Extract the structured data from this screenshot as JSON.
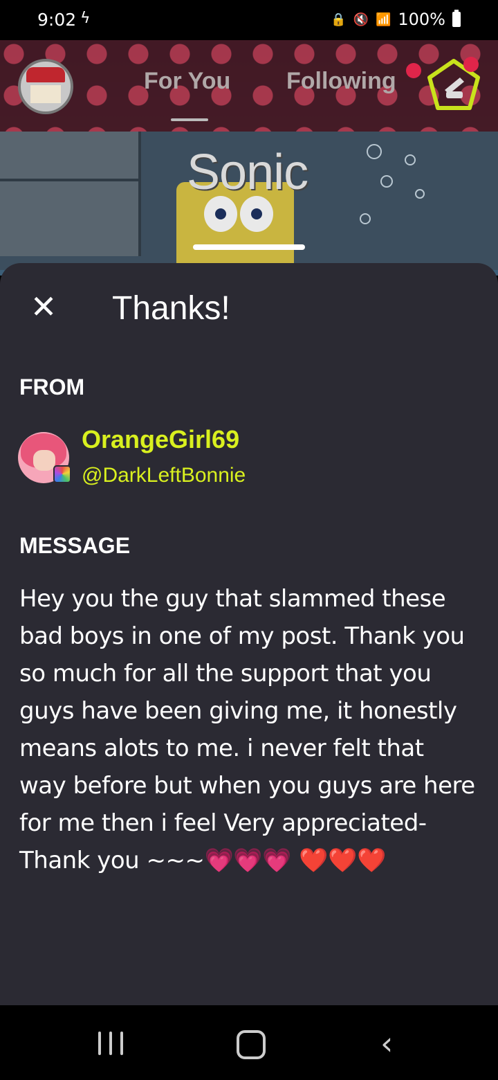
{
  "status_bar": {
    "time": "9:02",
    "bolt": "ϟ",
    "battery": "100%"
  },
  "video": {
    "caption": "Sonic"
  },
  "top_nav": {
    "tabs": [
      {
        "label": "For You",
        "active": true
      },
      {
        "label": "Following",
        "active": false
      }
    ]
  },
  "sheet": {
    "close": "✕",
    "title": "Thanks!",
    "from_label": "FROM",
    "sender": {
      "name": "OrangeGirl69",
      "handle": "@DarkLeftBonnie"
    },
    "message_label": "MESSAGE",
    "message": "Hey you the guy that slammed these bad boys in one of my post. Thank you so much for all the support that you guys have been giving me, it honestly means alots to me. i never felt that way before but when you guys are here for me then i feel Very appreciated- Thank you ~~~",
    "emoji_pink": "💗💗💗",
    "emoji_red": "❤️❤️❤️"
  },
  "colors": {
    "accent": "#d9f01f",
    "sheet_bg": "#2b2a33",
    "heart_pink": "#ff4fa8",
    "heart_red": "#e81f2a"
  },
  "icons": {
    "close": "close-icon",
    "create": "create-pentagon-icon",
    "recent": "recent-apps-icon",
    "home": "home-icon",
    "back": "back-icon"
  }
}
